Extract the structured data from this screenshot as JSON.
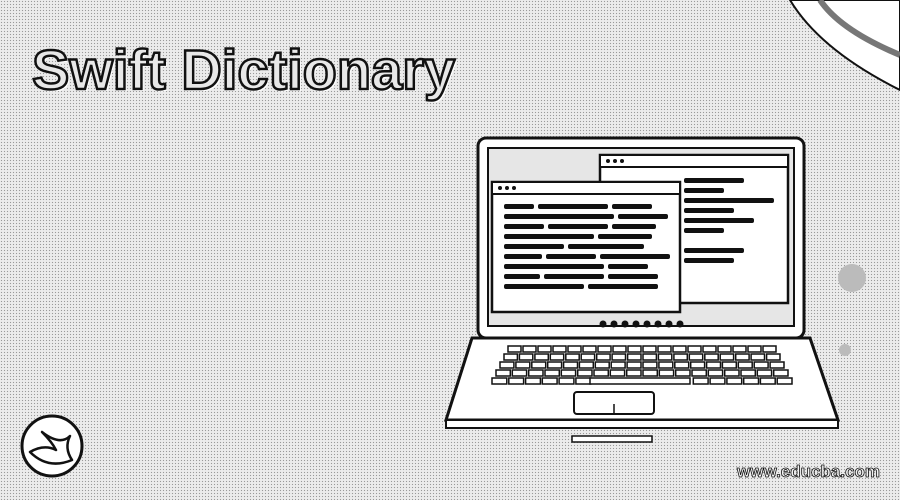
{
  "banner": {
    "title": "Swift Dictionary",
    "footer_url": "www.educba.com"
  },
  "icons": {
    "logo": "swift-logo-icon",
    "device": "laptop-icon",
    "windows": "code-window-icon"
  },
  "colors": {
    "ink": "#111111",
    "paper": "#ffffff",
    "dither": "#9a9a9a"
  }
}
